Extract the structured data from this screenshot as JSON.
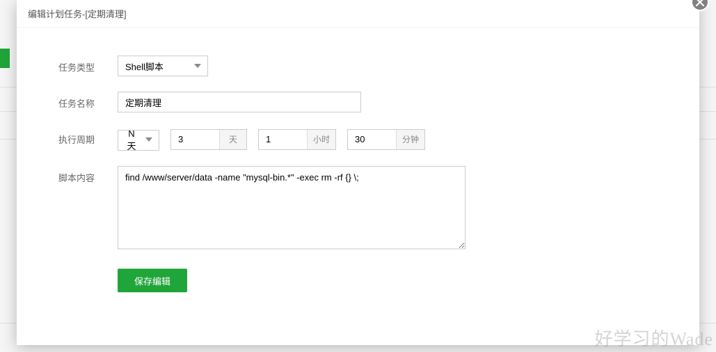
{
  "modal": {
    "title": "编辑计划任务-[定期清理]"
  },
  "labels": {
    "taskType": "任务类型",
    "taskName": "任务名称",
    "execCycle": "执行周期",
    "scriptContent": "脚本内容"
  },
  "values": {
    "taskType": "Shell脚本",
    "taskName": "定期清理",
    "cycleSelect": "N天",
    "days": "3",
    "hours": "1",
    "minutes": "30",
    "script": "find /www/server/data -name \"mysql-bin.*\" -exec rm -rf {} \\;"
  },
  "units": {
    "day": "天",
    "hour": "小时",
    "minute": "分钟"
  },
  "buttons": {
    "save": "保存编辑"
  },
  "watermark": "好学习的Wade"
}
